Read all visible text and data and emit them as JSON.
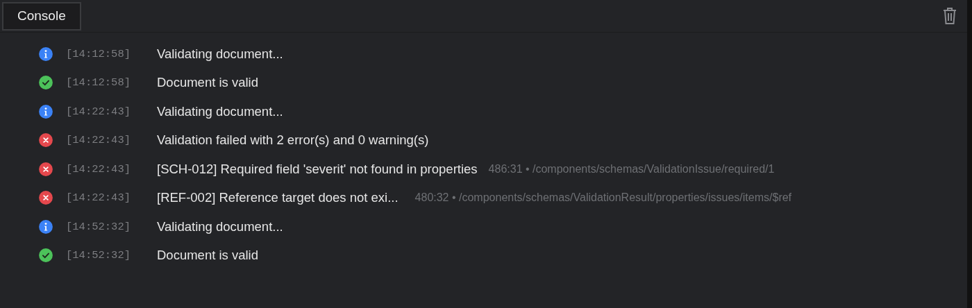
{
  "tabs": [
    {
      "label": "Console",
      "selected": true
    }
  ],
  "entries": [
    {
      "kind": "info",
      "time": "[14:12:58]",
      "message": "Validating document..."
    },
    {
      "kind": "success",
      "time": "[14:12:58]",
      "message": "Document is valid"
    },
    {
      "kind": "info",
      "time": "[14:22:43]",
      "message": "Validating document..."
    },
    {
      "kind": "error",
      "time": "[14:22:43]",
      "message": "Validation failed with 2 error(s) and 0 warning(s)"
    },
    {
      "kind": "error",
      "time": "[14:22:43]",
      "message": "[SCH-012] Required field 'severit' not found in properties",
      "location": "486:31 • /components/schemas/ValidationIssue/required/1"
    },
    {
      "kind": "error",
      "time": "[14:22:43]",
      "message": "[REF-002] Reference target does not exi...",
      "location": "480:32 • /components/schemas/ValidationResult/properties/issues/items/$ref"
    },
    {
      "kind": "info",
      "time": "[14:52:32]",
      "message": "Validating document..."
    },
    {
      "kind": "success",
      "time": "[14:52:32]",
      "message": "Document is valid"
    }
  ]
}
